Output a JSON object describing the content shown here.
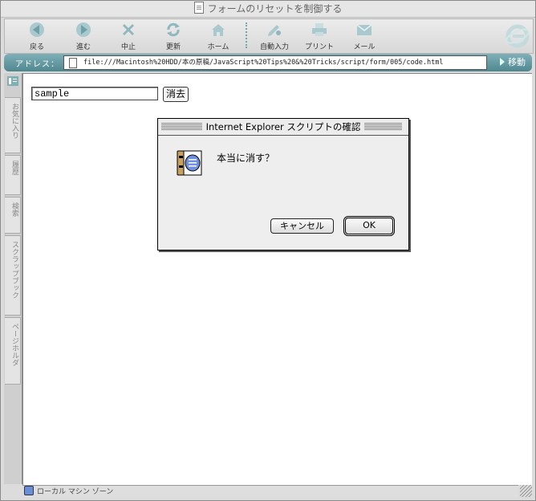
{
  "window": {
    "title": "フォームのリセットを制御する"
  },
  "toolbar": {
    "items": [
      {
        "label": "戻る",
        "icon": "back-arrow-icon"
      },
      {
        "label": "進む",
        "icon": "forward-arrow-icon"
      },
      {
        "label": "中止",
        "icon": "stop-x-icon"
      },
      {
        "label": "更新",
        "icon": "refresh-icon"
      },
      {
        "label": "ホーム",
        "icon": "home-icon"
      },
      {
        "label": "自動入力",
        "icon": "autofill-pencil-icon"
      },
      {
        "label": "プリント",
        "icon": "printer-icon"
      },
      {
        "label": "メール",
        "icon": "mail-envelope-icon"
      }
    ]
  },
  "address": {
    "label": "アドレス：",
    "url": "file:///Macintosh%20HDD/本の原稿/JavaScript%20Tips%20&%20Tricks/script/form/005/code.html",
    "go_label": "移動"
  },
  "sidebar": {
    "tabs": [
      "お気に入り",
      "履歴",
      "検索",
      "スクラップブック",
      "ページホルダ"
    ]
  },
  "page": {
    "input_value": "sample",
    "clear_label": "消去"
  },
  "dialog": {
    "title": "Internet Explorer スクリプトの確認",
    "message": "本当に消す？",
    "cancel_label": "キャンセル",
    "ok_label": "OK"
  },
  "status": {
    "zone": "ローカル マシン ゾーン"
  },
  "colors": {
    "accent": "#5e98a2",
    "icon_fill": "#a9c9cf"
  }
}
